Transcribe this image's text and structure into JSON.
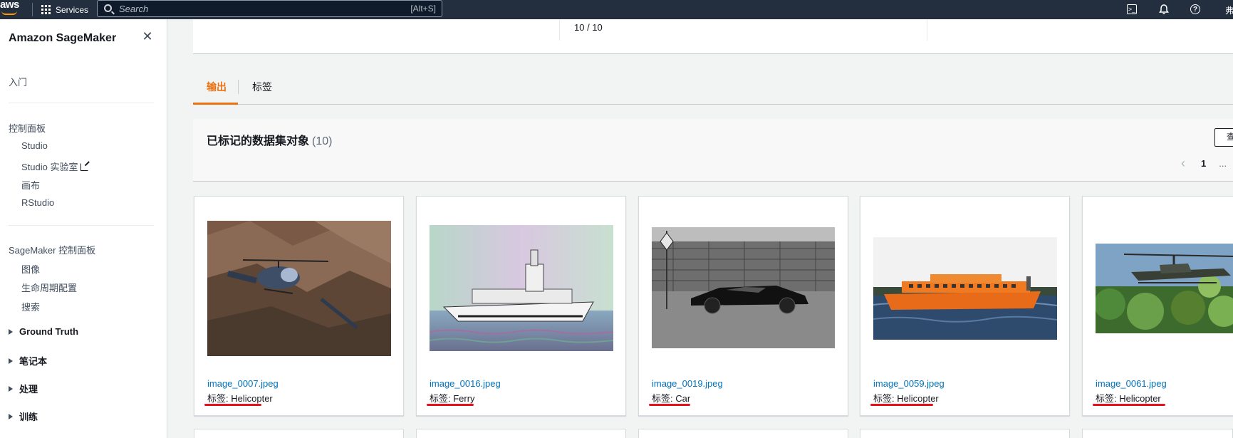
{
  "topnav": {
    "logo": "aws",
    "services_label": "Services",
    "search_placeholder": "Search",
    "search_shortcut": "[Alt+S]",
    "user_initial": "弗"
  },
  "sidebar": {
    "title": "Amazon SageMaker",
    "getting_started": "入门",
    "dashboard_section": "控制面板",
    "dashboard_items": [
      "Studio",
      "Studio 实验室",
      "画布",
      "RStudio"
    ],
    "sm_section": "SageMaker 控制面板",
    "sm_items": [
      "图像",
      "生命周期配置",
      "搜索"
    ],
    "expandables": [
      "Ground Truth",
      "笔记本",
      "处理",
      "训练"
    ]
  },
  "main": {
    "progress_text": "10 / 10",
    "tabs": [
      "输出",
      "标签"
    ],
    "dataset_title": "已标记的数据集对象",
    "dataset_count": "(10)",
    "view_button": "查",
    "pagination": {
      "current": "1",
      "more": "..."
    },
    "cards": [
      {
        "filename": "image_0007.jpeg",
        "label": "标签: Helicopter"
      },
      {
        "filename": "image_0016.jpeg",
        "label": "标签: Ferry"
      },
      {
        "filename": "image_0019.jpeg",
        "label": "标签: Car"
      },
      {
        "filename": "image_0059.jpeg",
        "label": "标签: Helicopter"
      },
      {
        "filename": "image_0061.jpeg",
        "label": "标签: Helicopter"
      }
    ]
  },
  "colors": {
    "nav_bg": "#232f3e",
    "accent_orange": "#ec7211",
    "link_blue": "#0073bb",
    "annotation_red": "#e6121c"
  }
}
